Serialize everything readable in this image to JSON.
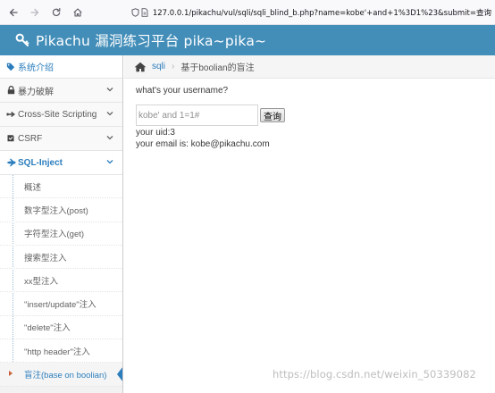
{
  "browser": {
    "url": "127.0.0.1/pikachu/vul/sqli/sqli_blind_b.php?name=kobe'+and+1%3D1%23&submit=查询"
  },
  "app": {
    "title": "Pikachu 漏洞练习平台 pika~pika~",
    "header_color": "#438eb9",
    "accent_color": "#2b7dbc"
  },
  "sidebar": {
    "items": [
      {
        "label": "系统介绍",
        "icon": "tag-icon"
      },
      {
        "label": "暴力破解",
        "icon": "lock-icon"
      },
      {
        "label": "Cross-Site Scripting",
        "icon": "wrench-icon"
      },
      {
        "label": "CSRF",
        "icon": "shield-icon"
      },
      {
        "label": "SQL-Inject",
        "icon": "fighter-jet-icon"
      }
    ],
    "sub_items": [
      "概述",
      "数字型注入(post)",
      "字符型注入(get)",
      "搜索型注入",
      "xx型注入",
      "\"insert/update\"注入",
      "\"delete\"注入",
      "\"http header\"注入",
      "盲注(base on boolian)"
    ]
  },
  "breadcrumb": {
    "section": "sqli",
    "page": "基于boolian的盲注"
  },
  "main": {
    "question": "what's your username?",
    "input_value": "kobe' and 1=1#",
    "submit_label": "查询",
    "result_uid": "your uid:3",
    "result_email": "your email is: kobe@pikachu.com"
  },
  "watermark": "https://blog.csdn.net/weixin_50339082"
}
